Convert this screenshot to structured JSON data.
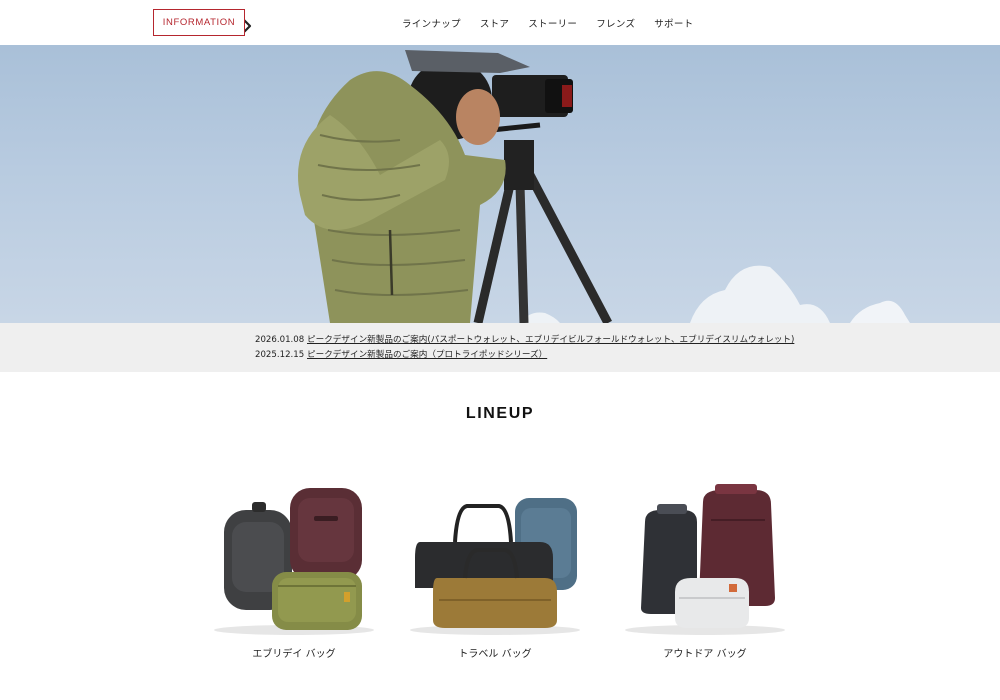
{
  "header": {
    "nav": [
      "ラインナップ",
      "ストア",
      "ストーリー",
      "フレンズ",
      "サポート"
    ]
  },
  "info": {
    "badge": "INFORMATION",
    "news": [
      {
        "date": "2026.01.08",
        "title": "ピークデザイン新製品のご案内(パスポートウォレット、エブリデイビルフォールドウォレット、エブリデイスリムウォレット)"
      },
      {
        "date": "2025.12.15",
        "title": "ピークデザイン新製品のご案内（プロトライポッドシリーズ）"
      }
    ]
  },
  "lineup": {
    "title": "LINEUP",
    "items": [
      {
        "label": "エブリデイ バッグ"
      },
      {
        "label": "トラベル バッグ"
      },
      {
        "label": "アウトドア バッグ"
      }
    ]
  },
  "colors": {
    "accent": "#b5262e",
    "info_background": "#efefef",
    "sky": "#b8cbe0"
  }
}
